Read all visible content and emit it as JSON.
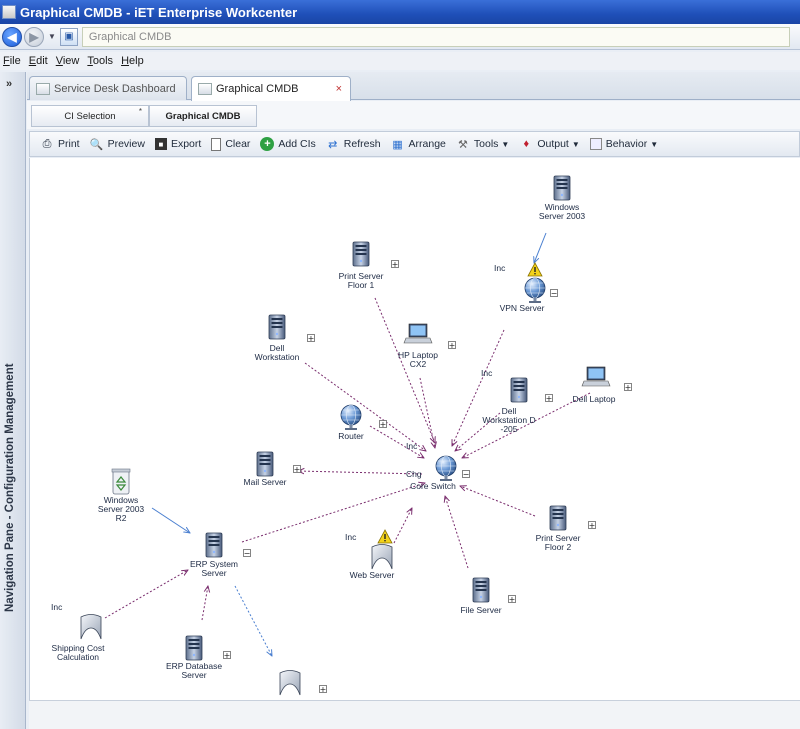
{
  "window": {
    "title": "Graphical CMDB  -  iET Enterprise Workcenter"
  },
  "address": {
    "value": "Graphical CMDB"
  },
  "menu": {
    "items": [
      {
        "first": "F",
        "rest": "ile"
      },
      {
        "first": "E",
        "rest": "dit"
      },
      {
        "first": "V",
        "rest": "iew"
      },
      {
        "first": "T",
        "rest": "ools"
      },
      {
        "first": "H",
        "rest": "elp"
      }
    ]
  },
  "navpane": {
    "label": "Navigation Pane - Configuration Management",
    "expand": "»"
  },
  "tabs": [
    {
      "label": "Service Desk Dashboard"
    },
    {
      "label": "Graphical CMDB",
      "close": "×"
    }
  ],
  "breadcrumbs": [
    {
      "label": "CI Selection",
      "marker": "*"
    },
    {
      "label": "Graphical CMDB"
    }
  ],
  "toolbar": {
    "print": "Print",
    "preview": "Preview",
    "export": "Export",
    "clear": "Clear",
    "add_cis": "Add CIs",
    "refresh": "Refresh",
    "arrange": "Arrange",
    "tools": "Tools",
    "output": "Output",
    "behavior": "Behavior"
  },
  "graph": {
    "nodes": {
      "win2003": {
        "lines": [
          "Windows",
          "Server 2003"
        ],
        "icon": "server-icon"
      },
      "vpn": {
        "lines": [
          "VPN Server"
        ],
        "icon": "globe-icon",
        "expander": "−"
      },
      "print1": {
        "lines": [
          "Print Server",
          "Floor 1"
        ],
        "icon": "server-icon",
        "expander": "+"
      },
      "dellws": {
        "lines": [
          "Dell",
          "Workstation"
        ],
        "icon": "server-icon",
        "expander": "+"
      },
      "hplaptop": {
        "lines": [
          "HP Laptop",
          "CX2"
        ],
        "icon": "laptop-icon",
        "expander": "+"
      },
      "dellws205": {
        "lines": [
          "Dell",
          "Workstation D",
          "-205"
        ],
        "icon": "server-icon",
        "expander": "+"
      },
      "delllaptop": {
        "lines": [
          "Dell Laptop"
        ],
        "icon": "laptop-icon",
        "expander": "+"
      },
      "router": {
        "lines": [
          "Router"
        ],
        "icon": "globe-icon",
        "expander": "+"
      },
      "mail": {
        "lines": [
          "Mail Server"
        ],
        "icon": "server-icon",
        "expander": "+"
      },
      "core": {
        "lines": [
          "Core Switch"
        ],
        "icon": "globe-icon",
        "expander": "−"
      },
      "win2003r2": {
        "lines": [
          "Windows",
          "Server 2003",
          "R2"
        ],
        "icon": "recycle-server-icon"
      },
      "erp": {
        "lines": [
          "ERP System",
          "Server"
        ],
        "icon": "server-icon",
        "expander": "−"
      },
      "web": {
        "lines": [
          "Web Server"
        ],
        "icon": "app-icon"
      },
      "print2": {
        "lines": [
          "Print Server",
          "Floor 2"
        ],
        "icon": "server-icon",
        "expander": "+"
      },
      "file": {
        "lines": [
          "File Server"
        ],
        "icon": "server-icon",
        "expander": "+"
      },
      "shipping": {
        "lines": [
          "Shipping Cost",
          "Calculation"
        ],
        "icon": "app-icon"
      },
      "erpdb": {
        "lines": [
          "ERP Database",
          "Server"
        ],
        "icon": "server-icon",
        "expander": "+"
      },
      "app_unnamed": {
        "lines": [],
        "icon": "app-icon",
        "expander": "+"
      }
    },
    "edge_labels": {
      "inc_vpn": "Inc",
      "inc_core_top": "Inc",
      "inc_mid": "Inc",
      "chg_core": "Chg",
      "inc_web": "Inc",
      "inc_shipping": "Inc"
    },
    "colors": {
      "dependency_edge": "#7a2e6e",
      "flow_edge": "#4a7fd0",
      "warning": "#f2d21a"
    }
  }
}
